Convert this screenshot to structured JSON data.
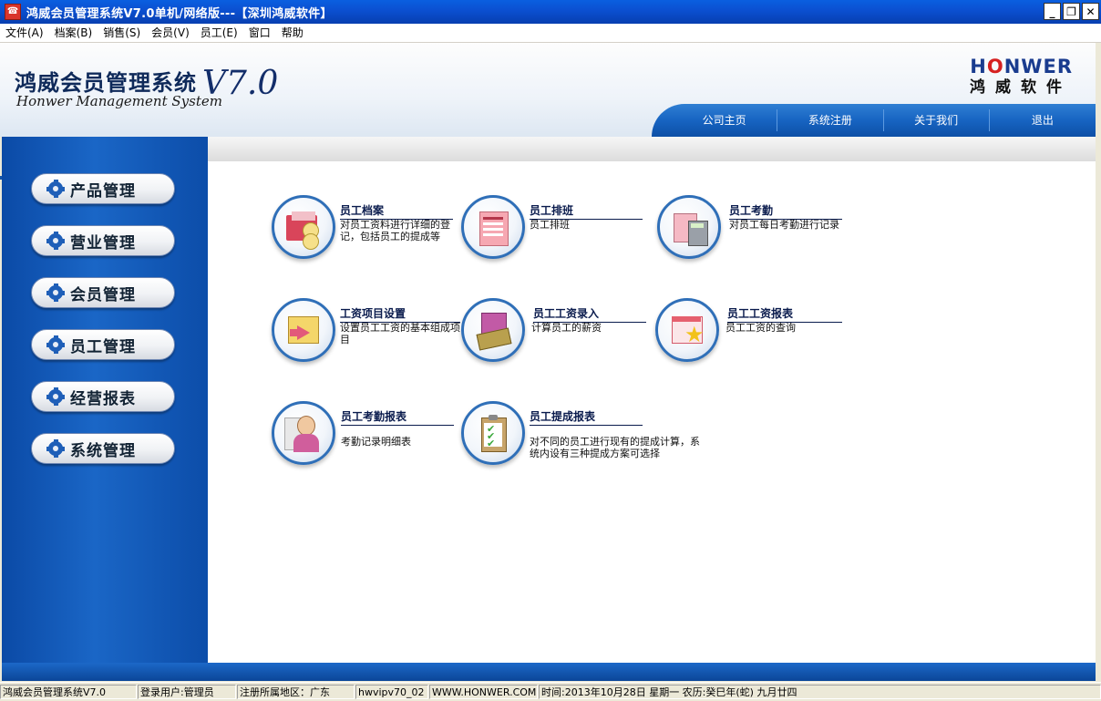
{
  "window": {
    "title": "鸿威会员管理系统V7.0单机/网络版---【深圳鸿威软件】",
    "icon": "app-icon",
    "buttons": [
      "minimize",
      "restore",
      "close"
    ]
  },
  "menu": [
    "文件(A)",
    "档案(B)",
    "销售(S)",
    "会员(V)",
    "员工(E)",
    "窗口",
    "帮助"
  ],
  "header": {
    "brand_cn": "鸿威会员管理系统",
    "brand_en": "Honwer Management System",
    "version": "V7.0",
    "logo_en_a": "H",
    "logo_en_b": "O",
    "logo_en_c": "NWER",
    "logo_cn": "鸿威软件",
    "nav": [
      "公司主页",
      "系统注册",
      "关于我们",
      "退出"
    ]
  },
  "sidebar": {
    "items": [
      "产品管理",
      "营业管理",
      "会员管理",
      "员工管理",
      "经营报表",
      "系统管理"
    ]
  },
  "modules": [
    {
      "title": "员工档案",
      "desc": "对员工资料进行详细的登记，包括员工的提成等",
      "icon": "folder-icon"
    },
    {
      "title": "员工排班",
      "desc": "员工排班",
      "icon": "schedule-icon"
    },
    {
      "title": "员工考勤",
      "desc": "对员工每日考勤进行记录",
      "icon": "calculator-icon"
    },
    {
      "title": "工资项目设置",
      "desc": "设置员工工资的基本组成项目",
      "icon": "chart-icon"
    },
    {
      "title": "员工工资录入",
      "desc": "计算员工的薪资",
      "icon": "money-icon"
    },
    {
      "title": "员工工资报表",
      "desc": "员工工资的查询",
      "icon": "star-report-icon"
    },
    {
      "title": "员工考勤报表",
      "desc": "考勤记录明细表",
      "icon": "person-icon"
    },
    {
      "title": "员工提成报表",
      "desc": "对不同的员工进行现有的提成计算，系统内设有三种提成方案可选择",
      "icon": "clipboard-icon"
    }
  ],
  "status": {
    "app": "鸿威会员管理系统V7.0",
    "user": "登录用户:管理员",
    "region": "注册所属地区：广东",
    "code": "hwvipv70_02",
    "url": "WWW.HONWER.COM",
    "time": "时间:2013年10月28日  星期一  农历:癸巳年(蛇) 九月廿四"
  }
}
